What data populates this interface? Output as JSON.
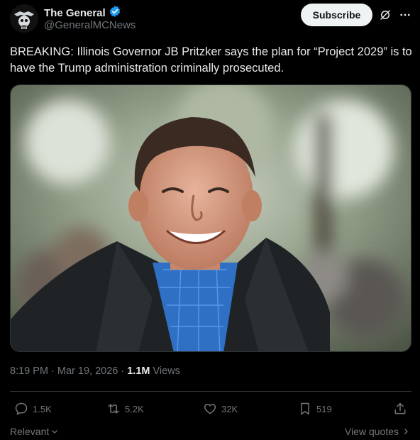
{
  "author": {
    "name": "The General",
    "handle": "@GeneralMCNews",
    "verified": true,
    "verified_color": "#1d9bf0"
  },
  "header": {
    "subscribe_label": "Subscribe",
    "grok_icon": "grok-icon",
    "more_icon": "more-icon"
  },
  "post": {
    "text": "BREAKING: Illinois Governor JB Pritzker says the plan for “Project 2029” is to have the Trump administration criminally prosecuted.",
    "image_icon": "photo-of-man-laughing"
  },
  "meta": {
    "time": "8:19 PM",
    "separator": " · ",
    "date": "Mar 19, 2026",
    "views_count": "1.1M",
    "views_label": "Views"
  },
  "actions": {
    "replies": "1.5K",
    "reposts": "5.2K",
    "likes": "32K",
    "bookmarks": "519"
  },
  "footer": {
    "relevant_label": "Relevant",
    "view_quotes_label": "View quotes"
  },
  "colors": {
    "background": "#000000",
    "text": "#e7e9ea",
    "secondary": "#71767b",
    "border": "#2f3336"
  }
}
